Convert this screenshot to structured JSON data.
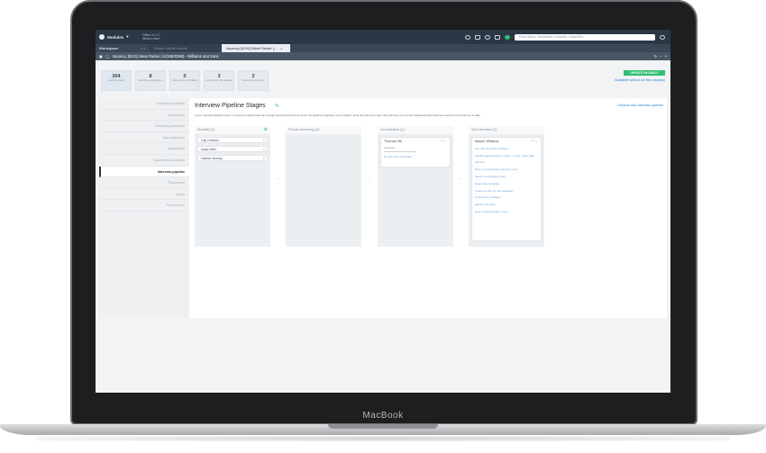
{
  "app": {
    "modules_label": "Modules",
    "office_line1": "Office v1.2.7",
    "office_line2": "What's new?",
    "search_placeholder": "Find clients, candidates, contacts, vacancies...",
    "workspace_label": "Workspace",
    "tab_blank_placeholder": "Search within results",
    "tab_active_label": "Vacancy [5241] Meat Packer (...",
    "window_title": "Vacancy [5241] Meat Packer (ACME/0396) - Williams and Sons"
  },
  "stats": [
    {
      "value": "304",
      "label": "website views"
    },
    {
      "value": "8",
      "label": "website applications"
    },
    {
      "value": "0",
      "label": "submitted candidates"
    },
    {
      "value": "3",
      "label": "shortlisted candidates"
    },
    {
      "value": "2",
      "label": "booked interviews"
    }
  ],
  "header": {
    "update_button": "UPDATE VACANCY",
    "available_actions": "Available actions for this vacancy"
  },
  "sidebar": {
    "items": [
      "General information",
      "Advertisers",
      "Screening questions",
      "Auto responder",
      "Applications",
      "Submitted candidates",
      "Interview pipeline",
      "Placements",
      "Notes",
      "Record links"
    ],
    "active_index": 6
  },
  "pipeline": {
    "title": "Interview Pipeline Stages",
    "unshow_link": "Unshow this interview pipeline",
    "info_text": "If your interview pipeline does not result in a placement we strongly recommend that you close the pipeline (marking it as complete) using the link to the right; this will keep your current dashboard and interview metrics correct and up to date",
    "columns": [
      {
        "title": "Shortlist (3)",
        "candidates": [
          "Lilly Graham",
          "Isaac Allen",
          "Nathan Murray"
        ]
      },
      {
        "title": "Phone screening (0)",
        "candidates": []
      },
      {
        "title": "1st interview (1)",
        "card": {
          "name": "Thomas Hill",
          "status": "Rejected",
          "link": "Re-open this candidate"
        }
      },
      {
        "title": "2nd interview (1)",
        "card": {
          "name": "Mason Williams",
          "actions": [
            "Sun 31st July 2016 10.30pm",
            "118 Birmingham Road, London, London, SW1 1HB",
            "Add files",
            "Book a second stage interview round",
            "Send a confirmation email",
            "Reject this candidate",
            "Create an offer for this candidate",
            "Contact this candidate",
            "Edit this interview",
            "Open / edit candidate record"
          ]
        }
      }
    ]
  },
  "device": {
    "brand": "MacBook"
  }
}
